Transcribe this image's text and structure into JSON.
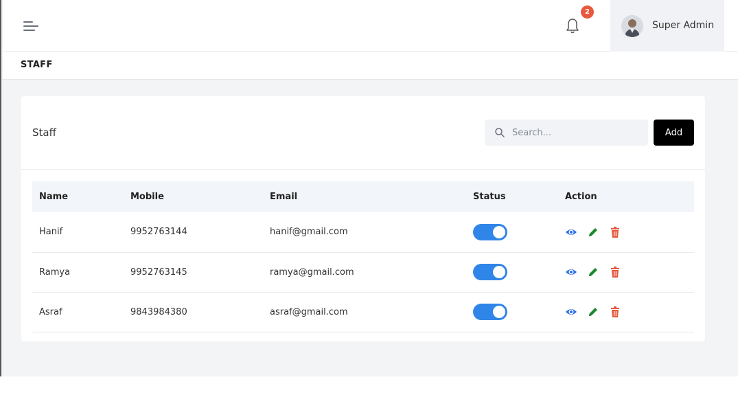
{
  "header": {
    "notification_count": "2",
    "user_name": "Super Admin"
  },
  "breadcrumb": {
    "title": "STAFF"
  },
  "card": {
    "title": "Staff",
    "search_placeholder": "Search...",
    "add_label": "Add"
  },
  "table": {
    "columns": [
      "Name",
      "Mobile",
      "Email",
      "Status",
      "Action"
    ],
    "rows": [
      {
        "name": "Hanif",
        "mobile": "9952763144",
        "email": "hanif@gmail.com",
        "status": "on"
      },
      {
        "name": "Ramya",
        "mobile": "9952763145",
        "email": "ramya@gmail.com",
        "status": "on"
      },
      {
        "name": "Asraf",
        "mobile": "9843984380",
        "email": "asraf@gmail.com",
        "status": "on"
      }
    ]
  },
  "colors": {
    "toggle_on": "#2f86e8",
    "view_icon": "#2f6fe6",
    "edit_icon": "#1d8a2c",
    "delete_icon": "#e8583e",
    "badge": "#e8583e"
  },
  "icons": [
    "menu-icon",
    "bell-icon",
    "avatar",
    "search-icon",
    "eye-icon",
    "pencil-icon",
    "trash-icon"
  ]
}
